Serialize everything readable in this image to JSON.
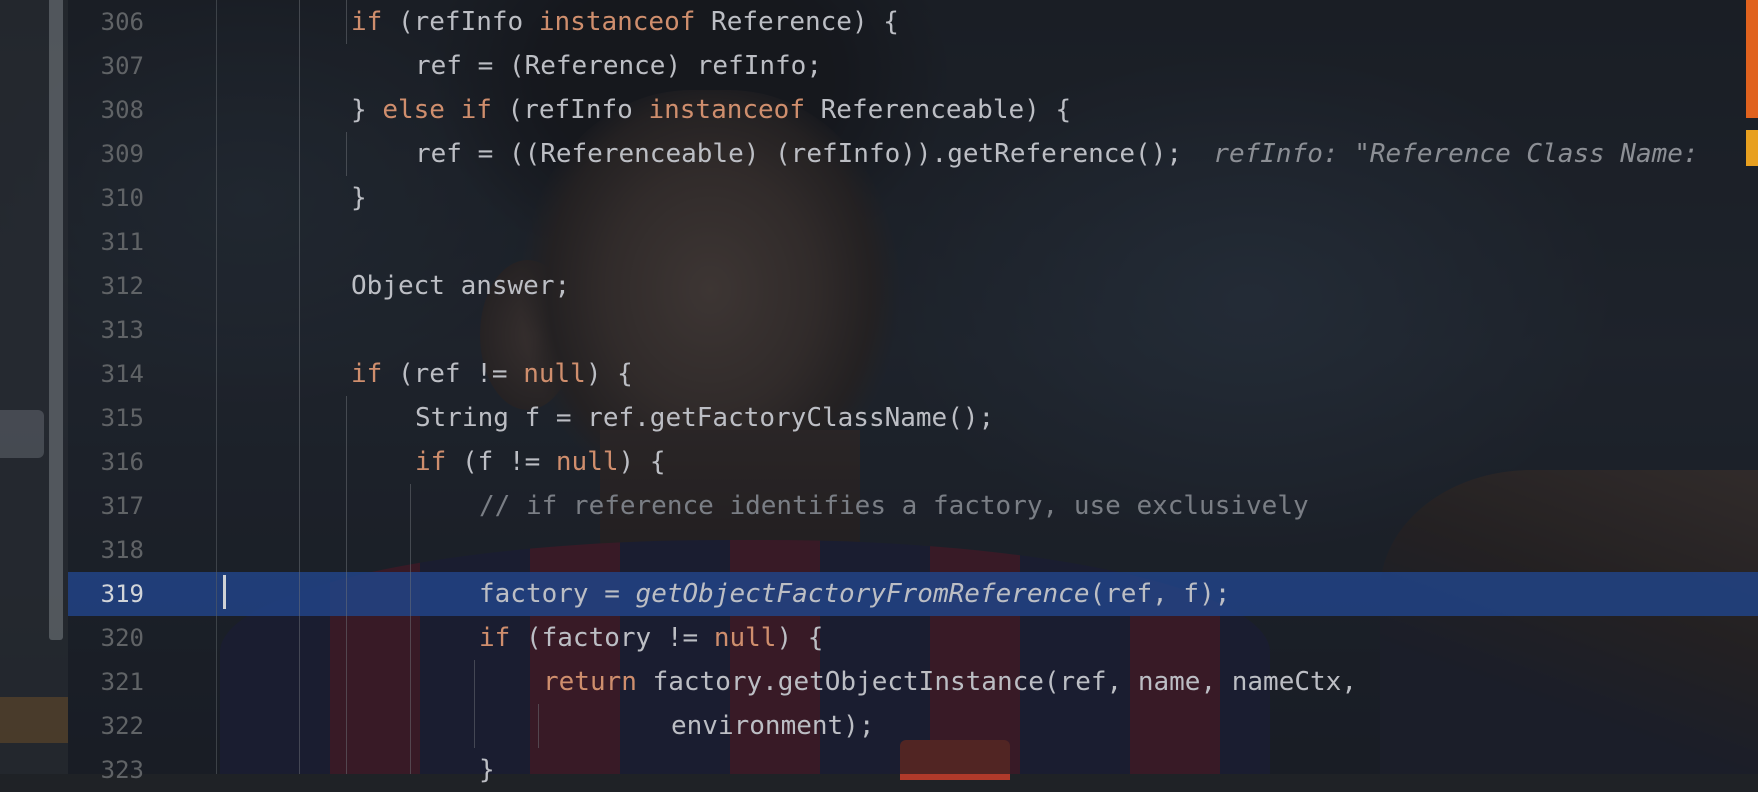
{
  "editor": {
    "lines": [
      {
        "num": "306",
        "indent": 1,
        "tokens": [
          {
            "t": "if",
            "c": "kw"
          },
          {
            "t": " (refInfo "
          },
          {
            "t": "instanceof",
            "c": "kw"
          },
          {
            "t": " Reference) {"
          }
        ]
      },
      {
        "num": "307",
        "indent": 2,
        "tokens": [
          {
            "t": "ref = (Reference) refInfo;"
          }
        ]
      },
      {
        "num": "308",
        "indent": 1,
        "tokens": [
          {
            "t": "} "
          },
          {
            "t": "else",
            "c": "kw"
          },
          {
            "t": " "
          },
          {
            "t": "if",
            "c": "kw"
          },
          {
            "t": " (refInfo "
          },
          {
            "t": "instanceof",
            "c": "kw"
          },
          {
            "t": " Referenceable) {"
          }
        ]
      },
      {
        "num": "309",
        "indent": 2,
        "tokens": [
          {
            "t": "ref = ((Referenceable) (refInfo)).getReference();"
          },
          {
            "t": "  refInfo: \"Reference Class Name: ",
            "c": "hint"
          }
        ]
      },
      {
        "num": "310",
        "indent": 1,
        "tokens": [
          {
            "t": "}"
          }
        ]
      },
      {
        "num": "311",
        "indent": 1,
        "tokens": []
      },
      {
        "num": "312",
        "indent": 1,
        "tokens": [
          {
            "t": "Object answer;"
          }
        ]
      },
      {
        "num": "313",
        "indent": 1,
        "tokens": []
      },
      {
        "num": "314",
        "indent": 1,
        "tokens": [
          {
            "t": "if",
            "c": "kw"
          },
          {
            "t": " (ref != "
          },
          {
            "t": "null",
            "c": "kw"
          },
          {
            "t": ") {"
          }
        ]
      },
      {
        "num": "315",
        "indent": 2,
        "tokens": [
          {
            "t": "String f = ref.getFactoryClassName();"
          }
        ]
      },
      {
        "num": "316",
        "indent": 2,
        "tokens": [
          {
            "t": "if",
            "c": "kw"
          },
          {
            "t": " (f != "
          },
          {
            "t": "null",
            "c": "kw"
          },
          {
            "t": ") {"
          }
        ]
      },
      {
        "num": "317",
        "indent": 3,
        "tokens": [
          {
            "t": "// if reference identifies a factory, use exclusively",
            "c": "cm"
          }
        ]
      },
      {
        "num": "318",
        "indent": 3,
        "tokens": []
      },
      {
        "num": "319",
        "indent": 3,
        "current": true,
        "tokens": [
          {
            "t": "factory = "
          },
          {
            "t": "getObjectFactoryFromReference",
            "c": "it"
          },
          {
            "t": "(ref, f);"
          }
        ]
      },
      {
        "num": "320",
        "indent": 3,
        "tokens": [
          {
            "t": "if",
            "c": "kw"
          },
          {
            "t": " (factory != "
          },
          {
            "t": "null",
            "c": "kw"
          },
          {
            "t": ") {"
          }
        ]
      },
      {
        "num": "321",
        "indent": 4,
        "tokens": [
          {
            "t": "return",
            "c": "kw"
          },
          {
            "t": " factory.getObjectInstance(ref, name, nameCtx,"
          }
        ]
      },
      {
        "num": "322",
        "indent": 6,
        "tokens": [
          {
            "t": "environment);"
          }
        ]
      },
      {
        "num": "323",
        "indent": 3,
        "tokens": [
          {
            "t": "}"
          }
        ]
      }
    ]
  },
  "colors": {
    "keyword": "#cf8e6d",
    "text": "#bcbec4",
    "comment": "#7a7e85",
    "current_line": "#214283",
    "error_stripe": "#e0621e",
    "warning_stripe": "#e8a020"
  }
}
